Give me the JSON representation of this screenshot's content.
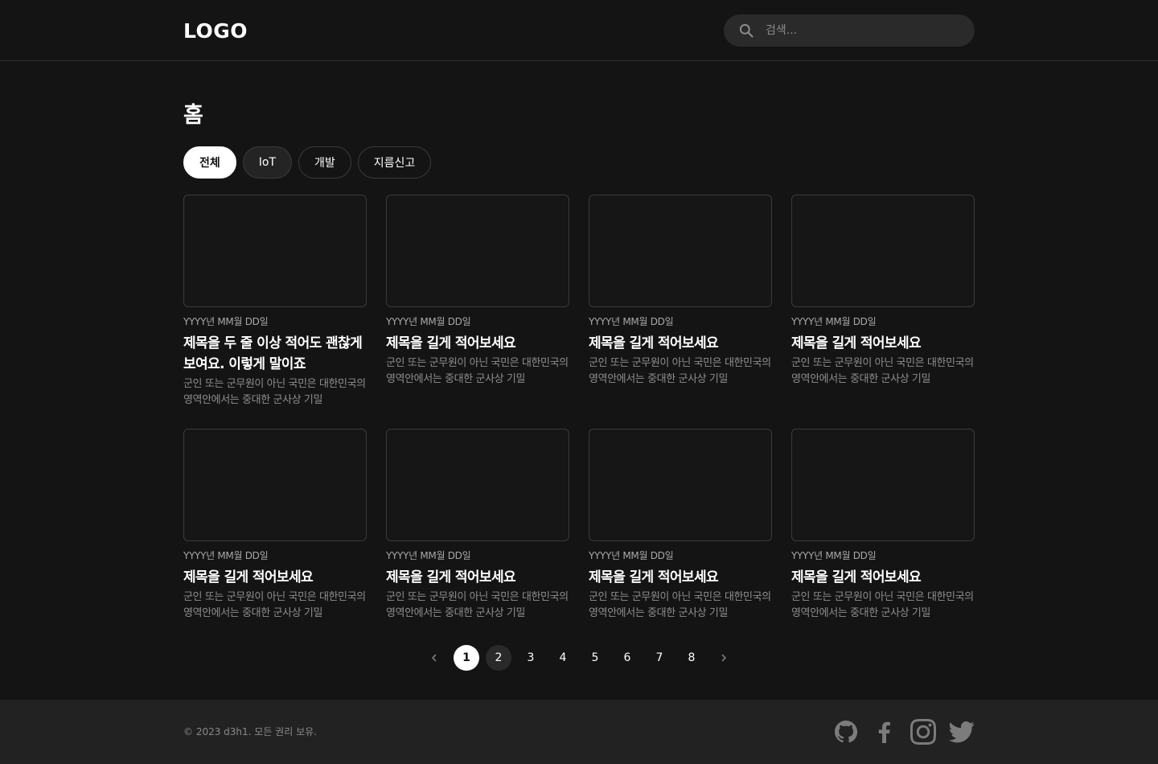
{
  "header": {
    "logo": "LOGO",
    "search_placeholder": "검색..."
  },
  "page": {
    "title": "홈"
  },
  "categories": [
    {
      "label": "전체",
      "active": true
    },
    {
      "label": "IoT",
      "active": false
    },
    {
      "label": "개발",
      "active": false
    },
    {
      "label": "지름신고",
      "active": false
    }
  ],
  "posts": [
    {
      "date": "YYYY년 MM월 DD일",
      "title": "제목을 두 줄 이상 적어도 괜찮게 보여요. 이렇게 말이죠",
      "excerpt": "군인 또는 군무원이 아닌 국민은 대한민국의 영역안에서는 중대한 군사상 기밀"
    },
    {
      "date": "YYYY년 MM월 DD일",
      "title": "제목을 길게 적어보세요",
      "excerpt": "군인 또는 군무원이 아닌 국민은 대한민국의 영역안에서는 중대한 군사상 기밀"
    },
    {
      "date": "YYYY년 MM월 DD일",
      "title": "제목을 길게 적어보세요",
      "excerpt": "군인 또는 군무원이 아닌 국민은 대한민국의 영역안에서는 중대한 군사상 기밀"
    },
    {
      "date": "YYYY년 MM월 DD일",
      "title": "제목을 길게 적어보세요",
      "excerpt": "군인 또는 군무원이 아닌 국민은 대한민국의 영역안에서는 중대한 군사상 기밀"
    },
    {
      "date": "YYYY년 MM월 DD일",
      "title": "제목을 길게 적어보세요",
      "excerpt": "군인 또는 군무원이 아닌 국민은 대한민국의 영역안에서는 중대한 군사상 기밀"
    },
    {
      "date": "YYYY년 MM월 DD일",
      "title": "제목을 길게 적어보세요",
      "excerpt": "군인 또는 군무원이 아닌 국민은 대한민국의 영역안에서는 중대한 군사상 기밀"
    },
    {
      "date": "YYYY년 MM월 DD일",
      "title": "제목을 길게 적어보세요",
      "excerpt": "군인 또는 군무원이 아닌 국민은 대한민국의 영역안에서는 중대한 군사상 기밀"
    },
    {
      "date": "YYYY년 MM월 DD일",
      "title": "제목을 길게 적어보세요",
      "excerpt": "군인 또는 군무원이 아닌 국민은 대한민국의 영역안에서는 중대한 군사상 기밀"
    }
  ],
  "pagination": {
    "prev_icon": "chevron-left-icon",
    "next_icon": "chevron-right-icon",
    "pages": [
      "1",
      "2",
      "3",
      "4",
      "5",
      "6",
      "7",
      "8"
    ],
    "current": "1"
  },
  "footer": {
    "copyright": "© 2023 d3h1. 모든 권리 보유.",
    "social_icons": [
      "github-icon",
      "facebook-icon",
      "instagram-icon",
      "twitter-icon"
    ]
  },
  "colors": {
    "background": "#141414",
    "footer_background": "#222222",
    "active_chip": "#ffffff",
    "muted_text": "#8e8e8e"
  }
}
